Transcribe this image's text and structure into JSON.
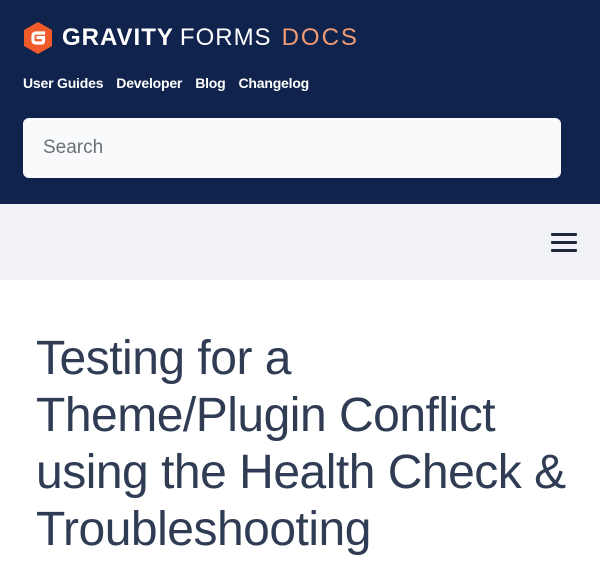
{
  "brand": {
    "gravity": "GRAVITY",
    "forms": "FORMS",
    "docs": "DOCS",
    "logo_letter": "G",
    "colors": {
      "header_bg": "#10234c",
      "accent": "#f15a2b",
      "docs_text": "#f19b74"
    }
  },
  "nav": {
    "items": [
      {
        "label": "User Guides"
      },
      {
        "label": "Developer"
      },
      {
        "label": "Blog"
      },
      {
        "label": "Changelog"
      }
    ]
  },
  "search": {
    "placeholder": "Search",
    "value": ""
  },
  "menu": {
    "icon": "hamburger-menu-icon"
  },
  "article": {
    "title": "Testing for a Theme/Plugin Conflict using the Health Check & Troubleshooting"
  }
}
